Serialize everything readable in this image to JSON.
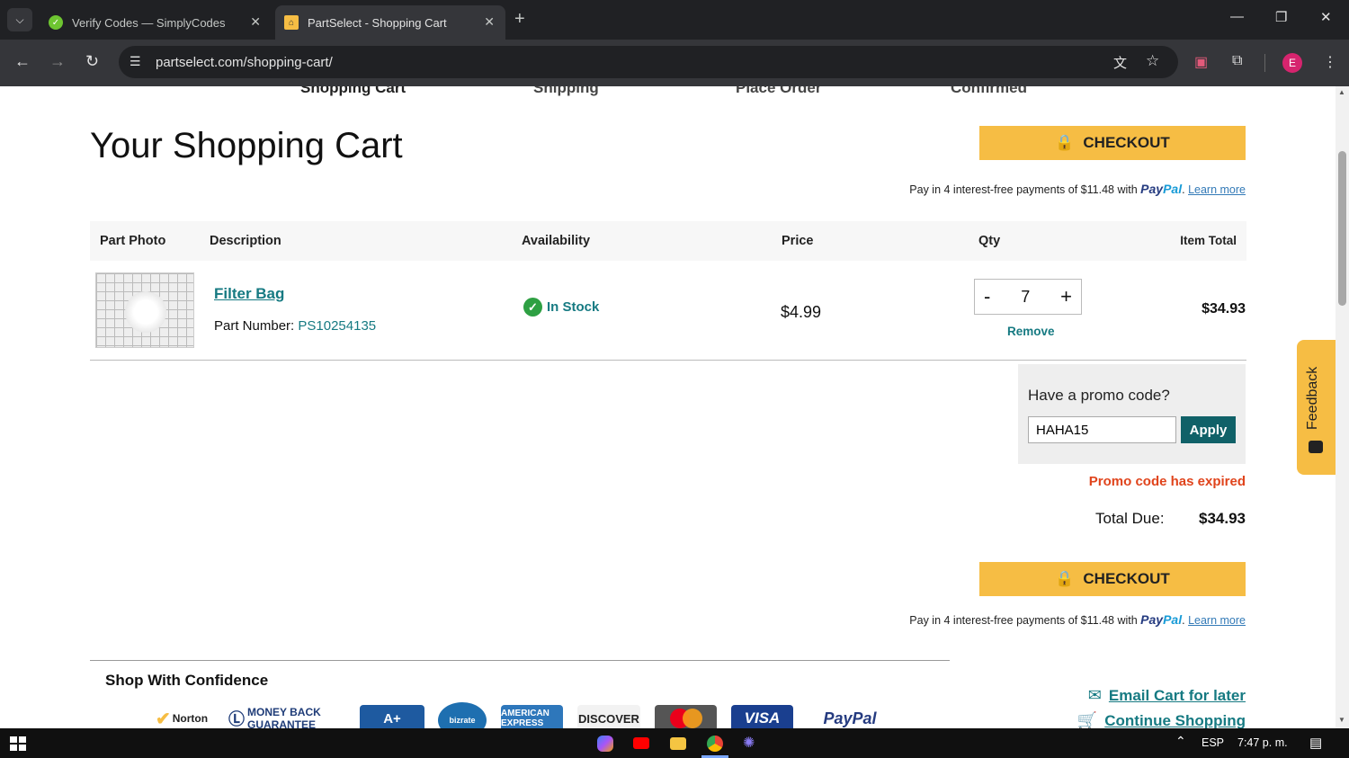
{
  "browser": {
    "tabs": [
      {
        "title": "Verify Codes — SimplyCodes",
        "active": false
      },
      {
        "title": "PartSelect - Shopping Cart",
        "active": true
      }
    ],
    "url": "partselect.com/shopping-cart/",
    "profile_initial": "E"
  },
  "steps": [
    "Shopping Cart",
    "Shipping",
    "Place Order",
    "Confirmed"
  ],
  "page_title": "Your Shopping Cart",
  "checkout_label": "CHECKOUT",
  "paypal": {
    "text": "Pay in 4 interest-free payments of $11.48 with",
    "brand_a": "Pay",
    "brand_b": "Pal",
    "learn_more": "Learn more"
  },
  "table": {
    "headers": [
      "Part Photo",
      "Description",
      "Availability",
      "Price",
      "Qty",
      "Item Total"
    ],
    "rows": [
      {
        "name": "Filter Bag",
        "part_number_label": "Part Number:",
        "part_number": "PS10254135",
        "availability": "In Stock",
        "price": "$4.99",
        "qty": "7",
        "qty_minus": "-",
        "qty_plus": "+",
        "remove": "Remove",
        "item_total": "$34.93"
      }
    ]
  },
  "promo": {
    "prompt": "Have a promo code?",
    "value": "HAHA15",
    "apply_label": "Apply",
    "error": "Promo code has expired"
  },
  "total": {
    "label": "Total Due:",
    "value": "$34.93"
  },
  "feedback_label": "Feedback",
  "confidence": {
    "heading": "Shop With Confidence",
    "badges": [
      "Norton",
      "MONEY BACK GUARANTEE",
      "A+",
      "bizrate",
      "AMERICAN EXPRESS",
      "DISCOVER",
      "mastercard",
      "VISA",
      "PayPal"
    ]
  },
  "side_links": {
    "email_cart": "Email Cart for later",
    "continue": "Continue Shopping"
  },
  "taskbar": {
    "lang": "ESP",
    "time": "7:47 p. m."
  },
  "colors": {
    "accent_yellow": "#f6bd44",
    "teal": "#167a82",
    "error": "#e0441c",
    "dark_teal_button": "#106168"
  }
}
